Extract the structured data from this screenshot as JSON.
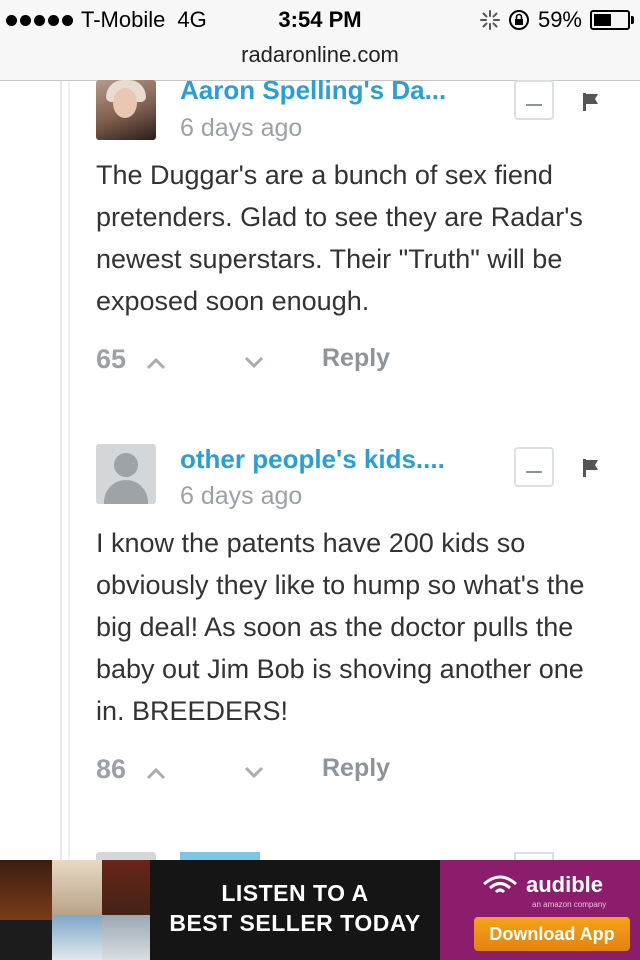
{
  "status_bar": {
    "carrier": "T-Mobile",
    "network": "4G",
    "time": "3:54 PM",
    "battery": "59%",
    "battery_level": 0.59
  },
  "browser": {
    "url": "radaronline.com"
  },
  "comments": [
    {
      "author": "Aaron Spelling's Da...",
      "time": "6 days ago",
      "text": "The Duggar's are a bunch of sex fiend pretenders. Glad to see they are Radar's newest superstars. Their \"Truth\" will be exposed soon enough.",
      "votes": "65",
      "reply_label": "Reply",
      "avatar": "photo"
    },
    {
      "author": "other people's kids....",
      "time": "6 days ago",
      "text": "I know the patents have 200 kids so obviously they like to hump so what's the big deal! As soon as the doctor pulls the baby out Jim Bob is shoving another one in. BREEDERS!",
      "votes": "86",
      "reply_label": "Reply",
      "avatar": "default"
    }
  ],
  "ad": {
    "headline_line1": "LISTEN TO A",
    "headline_line2": "BEST SELLER TODAY",
    "brand": "audible",
    "brand_sub": "an amazon company",
    "cta": "Download App"
  },
  "icons": [
    "signal-dots-icon",
    "activity-spinner-icon",
    "rotation-lock-icon",
    "battery-icon",
    "collapse-icon",
    "flag-icon",
    "upvote-icon",
    "downvote-icon",
    "audible-wifi-icon"
  ],
  "colors": {
    "author_link": "#2a9fd6",
    "muted": "#9aa1a7",
    "ad_purple": "#8c1c6c",
    "cta_orange": "#f29a18"
  }
}
